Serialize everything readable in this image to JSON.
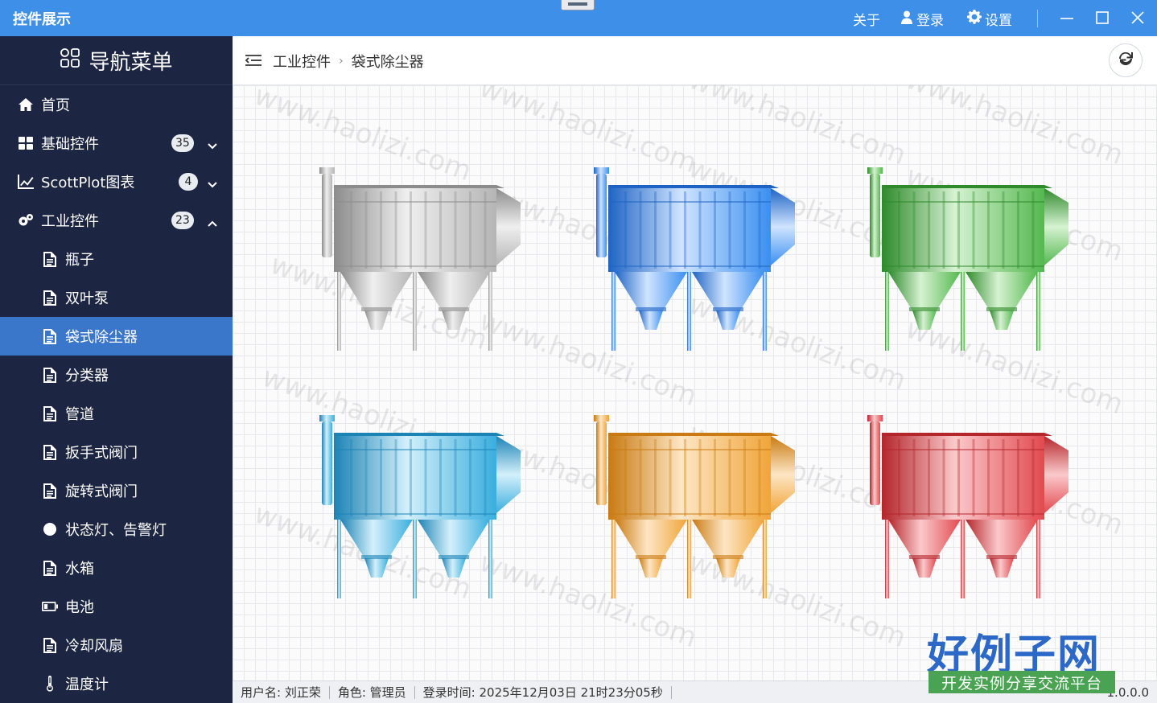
{
  "window": {
    "title": "控件展示",
    "menu": {
      "about": "关于",
      "login": "登录",
      "settings": "设置"
    }
  },
  "sidebar": {
    "header": "导航菜单",
    "items": [
      {
        "label": "首页",
        "icon": "home-icon"
      },
      {
        "label": "基础控件",
        "icon": "grid-icon",
        "badge": "35",
        "expanded": false
      },
      {
        "label": "ScottPlot图表",
        "icon": "chart-icon",
        "badge": "4",
        "expanded": false
      },
      {
        "label": "工业控件",
        "icon": "gears-icon",
        "badge": "23",
        "expanded": true
      }
    ],
    "sub_items": [
      {
        "label": "瓶子",
        "icon": "file-icon"
      },
      {
        "label": "双叶泵",
        "icon": "file-icon"
      },
      {
        "label": "袋式除尘器",
        "icon": "file-icon",
        "active": true
      },
      {
        "label": "分类器",
        "icon": "file-icon"
      },
      {
        "label": "管道",
        "icon": "file-icon"
      },
      {
        "label": "扳手式阀门",
        "icon": "file-icon"
      },
      {
        "label": "旋转式阀门",
        "icon": "file-icon"
      },
      {
        "label": "状态灯、告警灯",
        "icon": "circle-icon"
      },
      {
        "label": "水箱",
        "icon": "file-icon"
      },
      {
        "label": "电池",
        "icon": "battery-icon"
      },
      {
        "label": "冷却风扇",
        "icon": "file-icon"
      },
      {
        "label": "温度计",
        "icon": "thermometer-icon"
      }
    ]
  },
  "breadcrumb": {
    "parent": "工业控件",
    "current": "袋式除尘器"
  },
  "collectors": [
    {
      "color": "gray",
      "base": "#b5b5b5",
      "light": "#efefef",
      "dark": "#8c8c8c"
    },
    {
      "color": "blue",
      "base": "#3b8ff0",
      "light": "#cfe4ff",
      "dark": "#1e63c4"
    },
    {
      "color": "green",
      "base": "#54b84f",
      "light": "#d6f2d2",
      "dark": "#2e8a2b"
    },
    {
      "color": "cyan",
      "base": "#3aaede",
      "light": "#d3f0fb",
      "dark": "#1c83b5"
    },
    {
      "color": "orange",
      "base": "#f0a53a",
      "light": "#fde6c4",
      "dark": "#c97a12"
    },
    {
      "color": "red",
      "base": "#e14a4f",
      "light": "#fbc9cb",
      "dark": "#b3262b"
    }
  ],
  "watermark": "www.haolizi.com",
  "status": {
    "user": "用户名: 刘正荣",
    "role": "角色: 管理员",
    "login_time": "登录时间: 2025年12月03日 21时23分05秒",
    "version": "1.0.0.0"
  },
  "logo": {
    "title": "好例子网",
    "subtitle": "开发实例分享交流平台"
  }
}
